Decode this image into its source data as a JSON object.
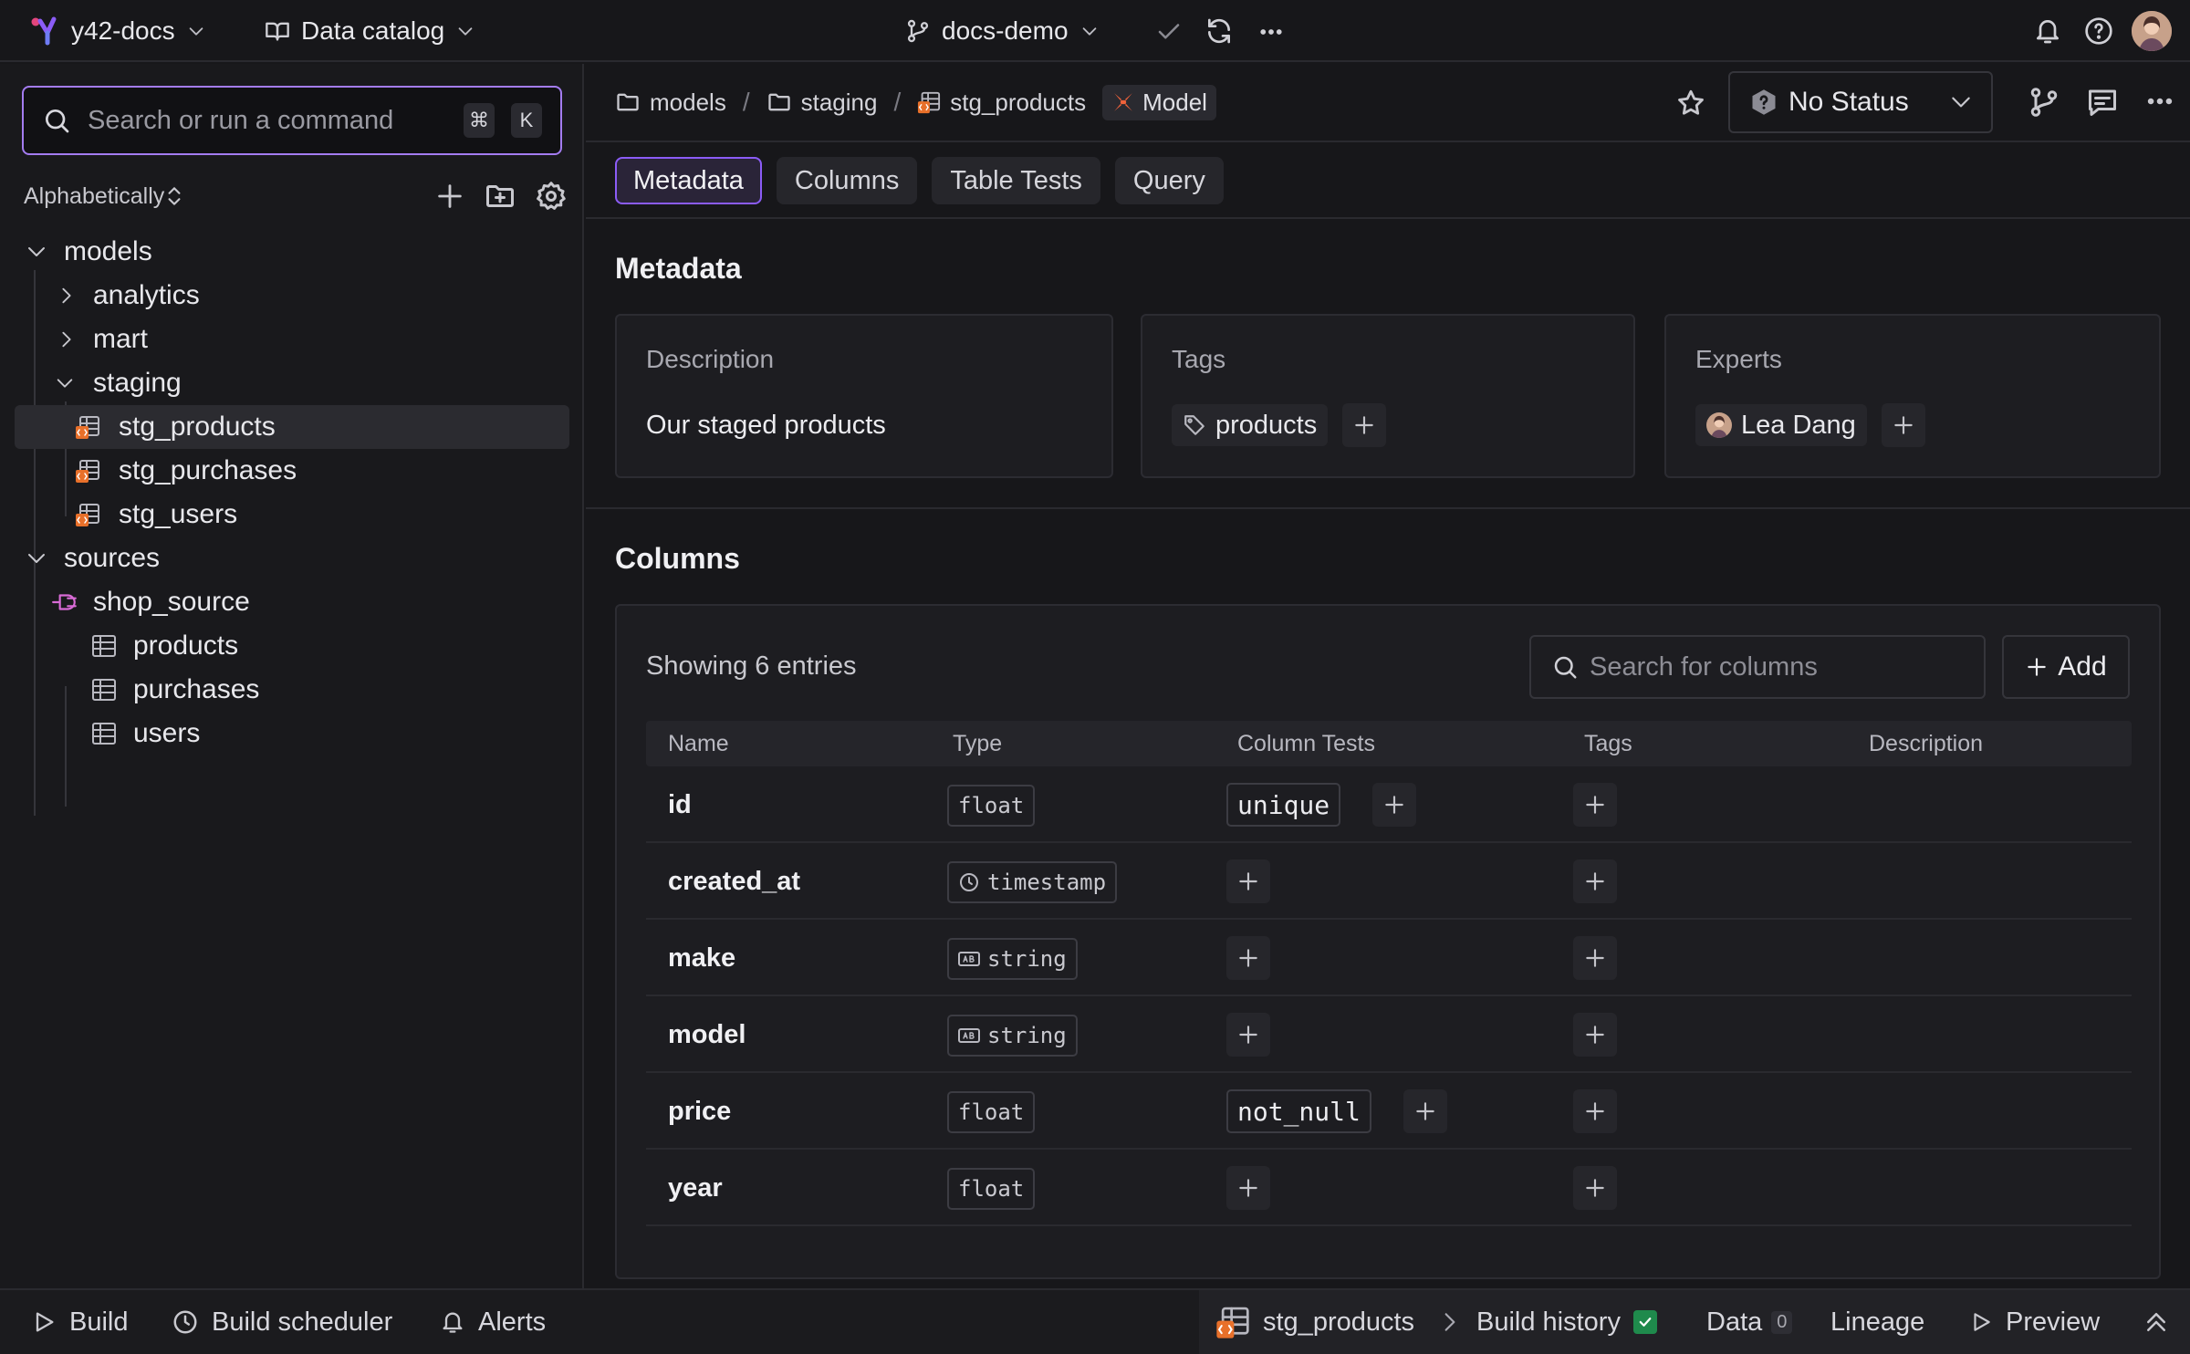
{
  "topbar": {
    "workspace": "y42-docs",
    "section": "Data catalog",
    "branch": "docs-demo"
  },
  "sidebar": {
    "search_placeholder": "Search or run a command",
    "shortcut_mod": "⌘",
    "shortcut_key": "K",
    "sort_label": "Alphabetically",
    "tree": {
      "models": "models",
      "analytics": "analytics",
      "mart": "mart",
      "staging": "staging",
      "stg_products": "stg_products",
      "stg_purchases": "stg_purchases",
      "stg_users": "stg_users",
      "sources": "sources",
      "shop_source": "shop_source",
      "products": "products",
      "purchases": "purchases",
      "users": "users"
    }
  },
  "breadcrumb": {
    "models": "models",
    "staging": "staging",
    "asset": "stg_products",
    "kind": "Model"
  },
  "status": {
    "label": "No Status"
  },
  "tabs": [
    "Metadata",
    "Columns",
    "Table Tests",
    "Query"
  ],
  "metadata": {
    "title": "Metadata",
    "description_title": "Description",
    "description": "Our staged products",
    "tags_title": "Tags",
    "tag": "products",
    "experts_title": "Experts",
    "expert": "Lea Dang"
  },
  "columns": {
    "title": "Columns",
    "showing": "Showing 6 entries",
    "search_placeholder": "Search for columns",
    "add_label": "Add",
    "headers": [
      "Name",
      "Type",
      "Column Tests",
      "Tags",
      "Description"
    ],
    "rows": [
      {
        "name": "id",
        "type": "float",
        "test": "unique"
      },
      {
        "name": "created_at",
        "type": "timestamp",
        "test": ""
      },
      {
        "name": "make",
        "type": "string",
        "test": ""
      },
      {
        "name": "model",
        "type": "string",
        "test": ""
      },
      {
        "name": "price",
        "type": "float",
        "test": "not_null"
      },
      {
        "name": "year",
        "type": "float",
        "test": ""
      }
    ]
  },
  "bottombar": {
    "build": "Build",
    "scheduler": "Build scheduler",
    "alerts": "Alerts",
    "asset": "stg_products",
    "history": "Build history",
    "data": "Data",
    "data_count": "0",
    "lineage": "Lineage",
    "preview": "Preview"
  },
  "colors": {
    "accent": "#8b5cf6",
    "model_orange": "#e8702a",
    "success": "#1f8a4c"
  }
}
